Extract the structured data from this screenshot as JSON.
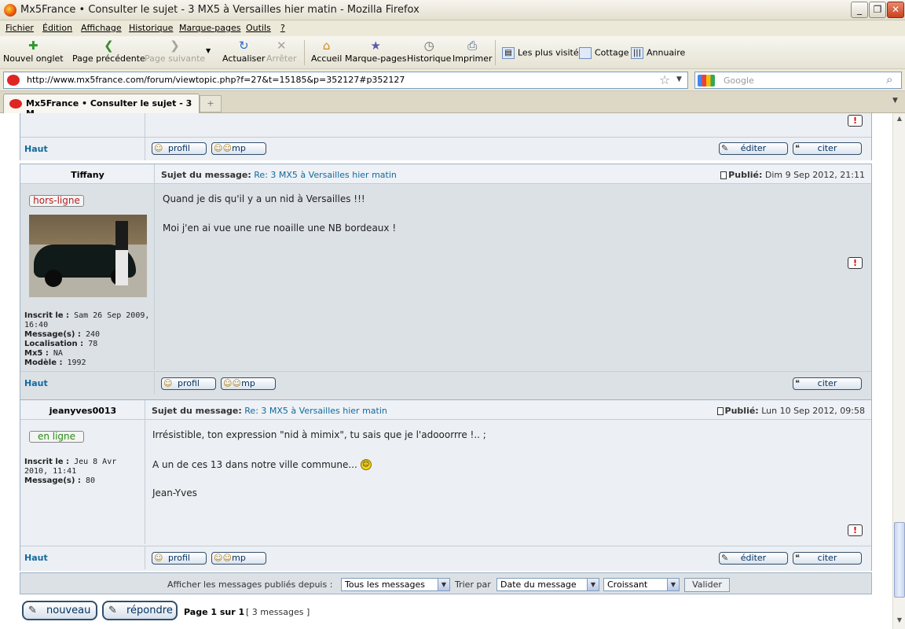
{
  "window": {
    "title": "Mx5France • Consulter le sujet - 3 MX5 à Versailles hier matin - Mozilla Firefox",
    "controls": [
      "_",
      "❐",
      "✕"
    ]
  },
  "menu": [
    "Fichier",
    "Édition",
    "Affichage",
    "Historique",
    "Marque-pages",
    "Outils",
    "?"
  ],
  "toolbar": {
    "new_tab": "Nouvel onglet",
    "back": "Page précédente",
    "forward": "Page suivante",
    "reload": "Actualiser",
    "stop": "Arrêter",
    "home": "Accueil",
    "bookmarks": "Marque-pages",
    "history": "Historique",
    "print": "Imprimer",
    "bookmarks_bar": [
      "Les plus visités",
      "Cottage",
      "Annuaire"
    ]
  },
  "urlbar": {
    "url": "http://www.mx5france.com/forum/viewtopic.php?f=27&t=15185&p=352127#p352127",
    "search_placeholder": "Google"
  },
  "tab": {
    "title": "Mx5France • Consulter le sujet - 3 M..."
  },
  "common": {
    "haut": "Haut",
    "profil": "profil",
    "mp": "mp",
    "editer": "éditer",
    "citer": "citer",
    "report": "!",
    "subject_label": "Sujet du message:",
    "published_label": "Publié:"
  },
  "posts": [
    {
      "author": "Tiffany",
      "status": "hors-ligne",
      "status_color": "#b41f1f",
      "subject": "Re: 3 MX5 à Versailles hier matin",
      "date": "Dim 9 Sep 2012, 21:11",
      "lines": [
        "Quand je dis qu'il y a un nid à Versailles !!!",
        "Moi j'en ai vue une rue noaille une NB bordeaux !"
      ],
      "info": [
        {
          "label": "Inscrit le :",
          "value": "Sam 26 Sep 2009, 16:40"
        },
        {
          "label": "Message(s) :",
          "value": "240"
        },
        {
          "label": "Localisation :",
          "value": "78"
        },
        {
          "label": "Mx5 :",
          "value": "NA"
        },
        {
          "label": "Modèle :",
          "value": "1992"
        }
      ]
    },
    {
      "author": "jeanyves0013",
      "status": "en ligne",
      "status_color": "#2a8a14",
      "subject": "Re: 3 MX5 à Versailles hier matin",
      "date": "Lun 10 Sep 2012, 09:58",
      "lines": [
        "Irrésistible, ton expression \"nid à mimix\", tu sais que je l'adooorrre !.. ;",
        "A un de ces 13 dans notre ville commune...",
        "Jean-Yves"
      ],
      "info": [
        {
          "label": "Inscrit le :",
          "value": "Jeu 8 Avr 2010, 11:41"
        },
        {
          "label": "Message(s) :",
          "value": "80"
        }
      ]
    }
  ],
  "sort_bar": {
    "label": "Afficher les messages publiés depuis :",
    "filter_value": "Tous les messages",
    "sort_label": "Trier par",
    "sort_value": "Date du message",
    "order_value": "Croissant",
    "submit": "Valider"
  },
  "pagination": {
    "new_topic": "nouveau",
    "reply": "répondre",
    "page": "Page 1 sur 1",
    "count": "[ 3 messages ]"
  }
}
